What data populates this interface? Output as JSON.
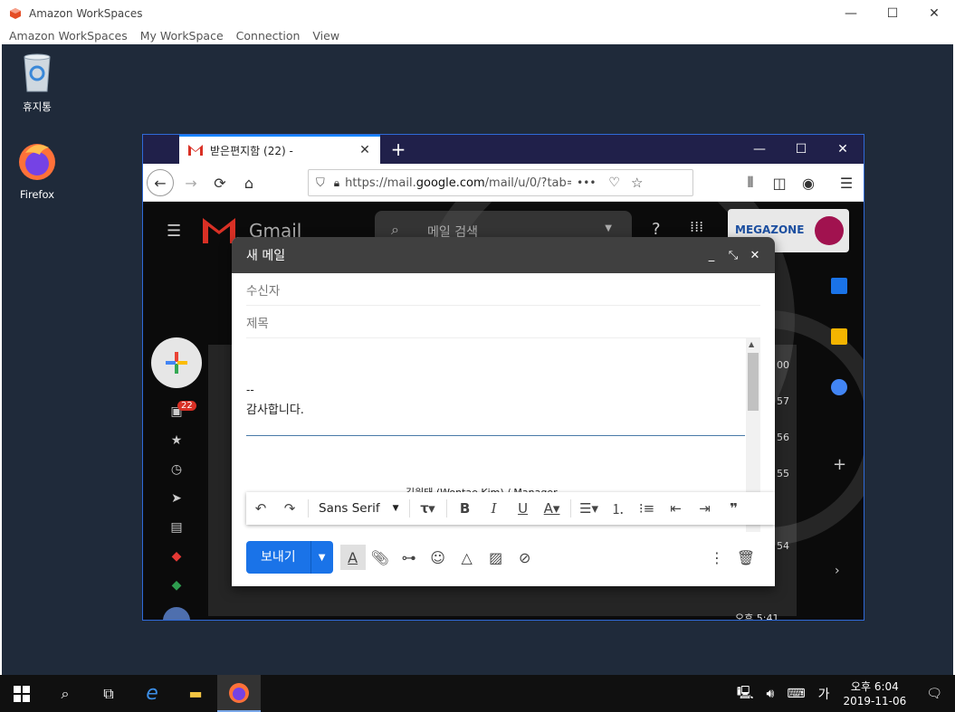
{
  "app": {
    "title": "Amazon WorkSpaces",
    "menu": [
      "Amazon WorkSpaces",
      "My WorkSpace",
      "Connection",
      "View"
    ]
  },
  "desktop": {
    "icons": [
      {
        "label": "휴지통",
        "icon": "recycle-bin-icon"
      },
      {
        "label": "Firefox",
        "icon": "firefox-icon"
      }
    ]
  },
  "browser": {
    "tab_title": "받은편지함 (22) -",
    "new_tab": "+",
    "url_prefix": "https://mail.",
    "url_domain": "google.com",
    "url_suffix": "/mail/u/0/?tab=",
    "url_more": "•••"
  },
  "gmail": {
    "logo_text": "Gmail",
    "search_placeholder": "메일 검색",
    "inbox_badge": "22",
    "account_brand": "MEGAZONE",
    "row_time_last": "오후 5:41",
    "row_numbers": [
      "00",
      "57",
      "56",
      "55",
      "54"
    ]
  },
  "compose": {
    "title": "새 메일",
    "to_label": "수신자",
    "subject_label": "제목",
    "signature_dash": "--",
    "signature_thanks": "감사합니다.",
    "signature_name": "김원태 (Wontae Kim) / Manager",
    "font_name": "Sans Serif",
    "send_label": "보내기"
  },
  "taskbar": {
    "ime": "가",
    "time": "오후 6:04",
    "date": "2019-11-06"
  },
  "colors": {
    "desktop_bg": "#1f2a3a",
    "firefox_tabbar": "#20204a",
    "send_button": "#1a73e8",
    "compose_header": "#404040"
  }
}
